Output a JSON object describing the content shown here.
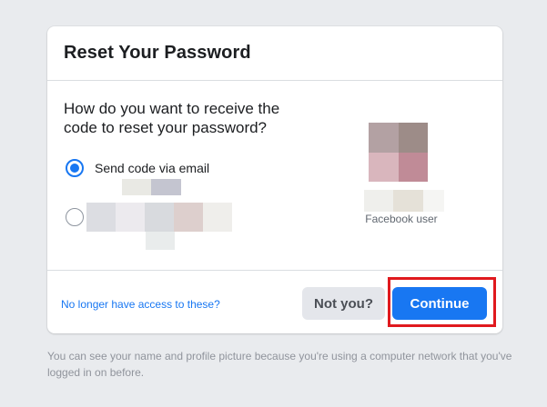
{
  "dialog": {
    "title": "Reset Your Password",
    "question": "How do you want to receive the code to reset your password?",
    "options": [
      {
        "label": "Send code via email",
        "selected": true
      },
      {
        "label": "",
        "selected": false
      }
    ]
  },
  "user": {
    "label": "Facebook user",
    "avatar_colors": [
      "#b3a1a3",
      "#9d8c88",
      "#d9b6bd",
      "#c08b97"
    ]
  },
  "footer": {
    "no_access_link": "No longer have access to these?",
    "not_you_label": "Not you?",
    "continue_label": "Continue"
  },
  "footnote": "You can see your name and profile picture because you're using a computer network that you've logged in on before.",
  "colors": {
    "accent": "#1877f2",
    "highlight": "#e0191e",
    "background": "#e9ebee"
  }
}
